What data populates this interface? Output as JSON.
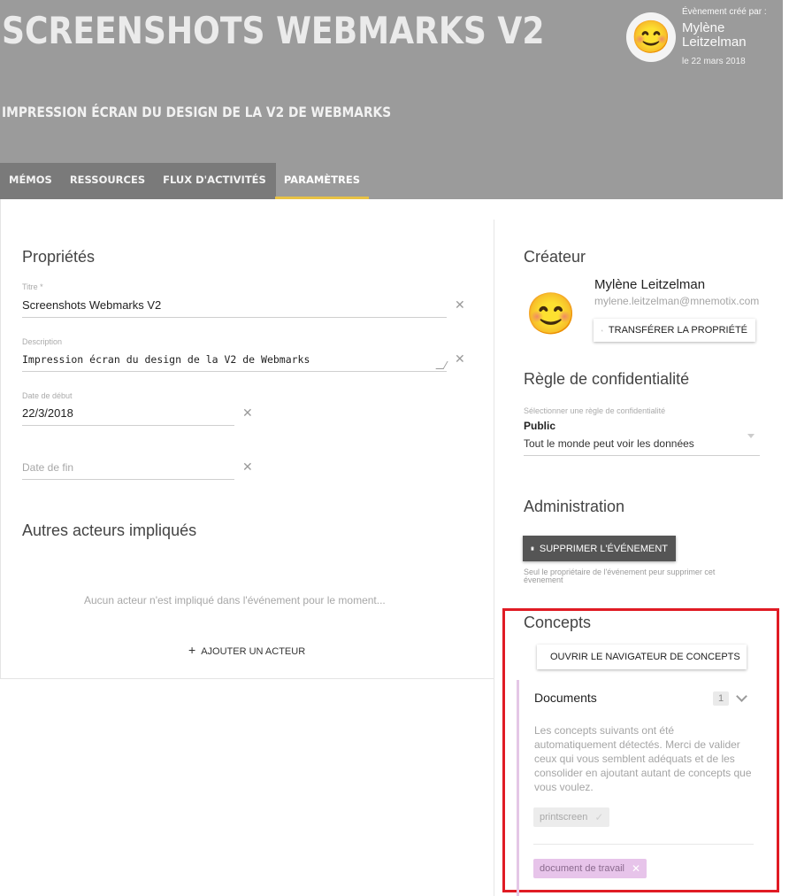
{
  "header": {
    "title": "SCREENSHOTS WEBMARKS V2",
    "subtitle": "IMPRESSION ÉCRAN DU DESIGN DE LA V2 DE WEBMARKS",
    "created_by_label": "Évènement créé par :",
    "creator_first": "Mylène",
    "creator_last": "Leitzelman",
    "created_date": "le 22 mars 2018",
    "avatar_emoji": "😊"
  },
  "tabs": [
    {
      "label": "MÉMOS"
    },
    {
      "label": "RESSOURCES"
    },
    {
      "label": "FLUX D'ACTIVITÉS"
    },
    {
      "label": "PARAMÈTRES"
    }
  ],
  "properties": {
    "title": "Propriétés",
    "titre_label": "Titre *",
    "titre_value": "Screenshots Webmarks V2",
    "description_label": "Description",
    "description_value": "Impression écran du design de la V2 de Webmarks",
    "start_label": "Date de début",
    "start_value": "22/3/2018",
    "end_placeholder": "Date de fin",
    "clear_icon": "✕"
  },
  "actors": {
    "title": "Autres acteurs impliqués",
    "empty_message": "Aucun acteur n'est impliqué dans l'événement pour le moment...",
    "add_label": "AJOUTER UN ACTEUR",
    "add_icon": "+"
  },
  "creator": {
    "title": "Créateur",
    "name": "Mylène Leitzelman",
    "email": "mylene.leitzelman@mnemotix.com",
    "transfer_label": "TRANSFÉRER LA PROPRIÉTÉ",
    "transfer_icon": "person-walking-icon"
  },
  "privacy": {
    "title": "Règle de confidentialité",
    "select_label": "Sélectionner une règle de confidentialité",
    "selected": "Public",
    "selected_desc": "Tout le monde peut voir les données"
  },
  "admin": {
    "title": "Administration",
    "delete_label": "SUPPRIMER L'ÉVÉNEMENT",
    "delete_icon": "trash-icon",
    "note": "Seul le propriétaire de l'événement peur supprimer cet évenement"
  },
  "concepts": {
    "title": "Concepts",
    "open_label": "OUVRIR LE NAVIGATEUR DE CONCEPTS",
    "open_icon": "tag-icon",
    "documents_title": "Documents",
    "documents_count": "1",
    "documents_text": "Les concepts suivants ont été automatiquement détectés.  Merci de valider ceux qui vous semblent adéquats et de les consolider en ajoutant autant de concepts que vous voulez.",
    "suggested_chip": "printscreen",
    "selected_chip": "document de travail"
  },
  "colors": {
    "header_bg": "#9b9b9b",
    "tab_bg": "#7a7a7a",
    "tab_active_underline": "#e8c245",
    "highlight": "#e01b24",
    "chip_selected": "#e7c4ea"
  }
}
